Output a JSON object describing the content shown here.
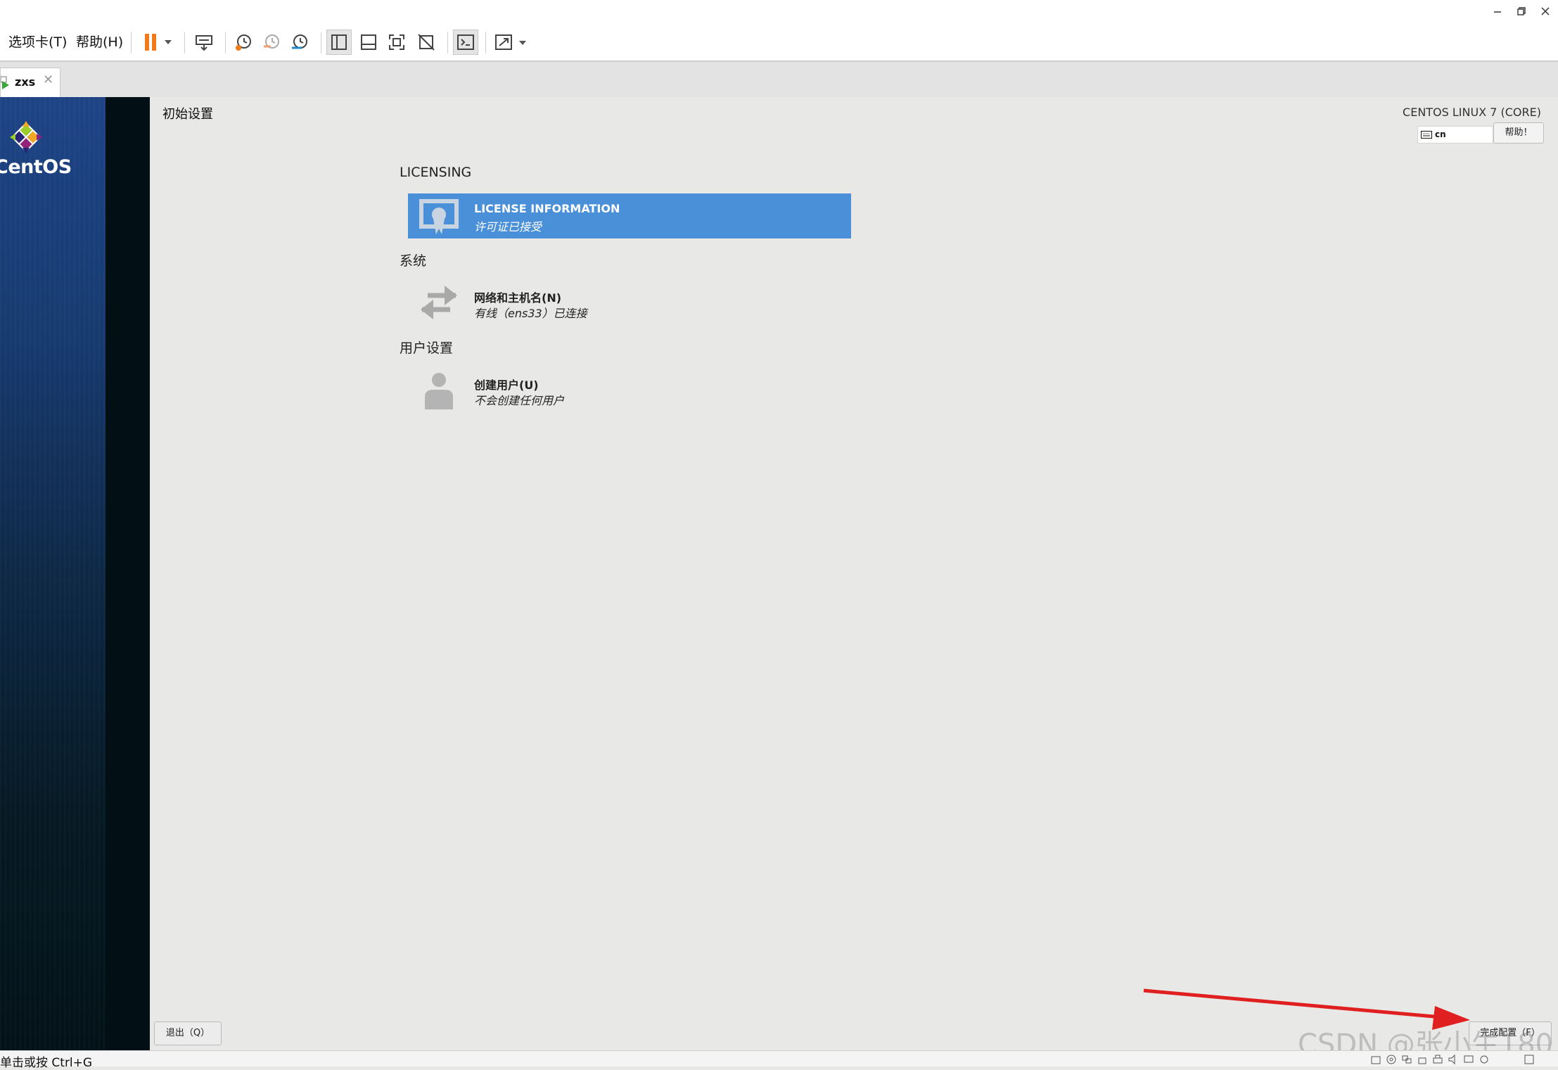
{
  "toolbar": {
    "menu_tabs": "选项卡(T)",
    "menu_help": "帮助(H)"
  },
  "tab": {
    "label": "zxs"
  },
  "vm": {
    "brand": "CentOS",
    "page_title": "初始设置",
    "os_name": "CENTOS LINUX 7 (CORE)",
    "keyboard_layout": "cn",
    "help_button": "帮助！",
    "sections": {
      "licensing": "LICENSING",
      "system": "系统",
      "user_settings": "用户设置"
    },
    "spokes": {
      "license": {
        "name": "LICENSE INFORMATION",
        "status": "许可证已接受"
      },
      "network": {
        "name": "网络和主机名(N)",
        "status": "有线（ens33）已连接"
      },
      "user": {
        "name": "创建用户(U)",
        "status": "不会创建任何用户"
      }
    },
    "quit_button": "退出（Q）",
    "finish_button": "完成配置（F）"
  },
  "watermark": "CSDN @张小生180",
  "statusbar": {
    "hint": "单击或按 Ctrl+G"
  },
  "colors": {
    "selected_spoke": "#4a90d9",
    "pause_icon": "#f07b1d",
    "annotation_arrow": "#e02020",
    "sidebar_dark": "#020f14",
    "sidebar_blue": "#1f4486"
  }
}
